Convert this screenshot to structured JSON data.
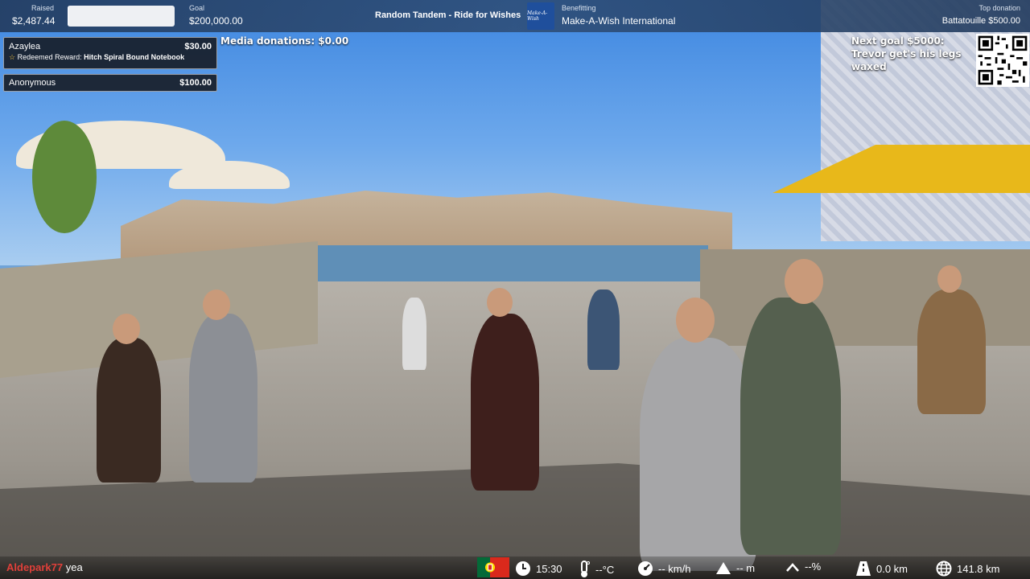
{
  "header": {
    "raised_label": "Raised",
    "raised_value": "$2,487.44",
    "raised_fraction": 0.012,
    "goal_label": "Goal",
    "goal_value": "$200,000.00",
    "title": "Random Tandem - Ride for Wishes",
    "logo_text": "Make-A-Wish",
    "benefitting_label": "Benefitting",
    "benefitting_value": "Make-A-Wish International",
    "top_donation_label": "Top donation",
    "top_donation_value": "Battatouille $500.00"
  },
  "donations": [
    {
      "name": "Azaylea",
      "amount": "$30.00",
      "reward_prefix": "Redeemed Reward:",
      "reward_item": "Hitch Spiral Bound Notebook"
    },
    {
      "name": "Anonymous",
      "amount": "$100.00"
    }
  ],
  "media_donations": "Media donations: $0.00",
  "next_goal": "Next goal $5000: Trevor get's his legs waxed",
  "chat": {
    "user": "Aldepark77",
    "message": "yea"
  },
  "telemetry": {
    "time": "15:30",
    "temperature": "--°C",
    "speed": "-- km/h",
    "elevation": "-- m",
    "grade": "--%",
    "distance_today": "0.0 km",
    "distance_total": "141.8 km"
  },
  "colors": {
    "topbar": "#2d4b73",
    "chat_user": "#e0403a",
    "flag_green": "#046a38",
    "flag_red": "#da291c"
  }
}
